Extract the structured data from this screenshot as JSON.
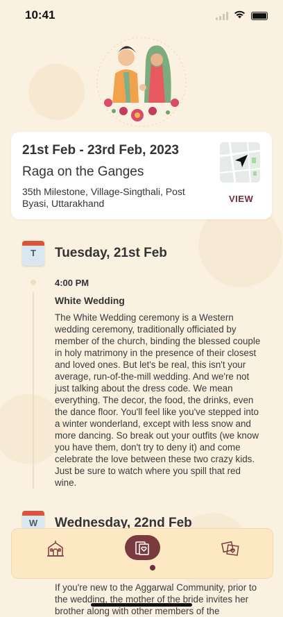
{
  "status_bar": {
    "time": "10:41"
  },
  "event": {
    "dates": "21st Feb - 23rd Feb, 2023",
    "venue": "Raga on the Ganges",
    "address": "35th Milestone, Village-Singthali, Post Byasi, Uttarakhand",
    "view_label": "VIEW"
  },
  "schedule": {
    "days": [
      {
        "calendar_letter": "T",
        "title": "Tuesday, 21st Feb",
        "sessions": [
          {
            "time": "4:00 PM",
            "title": "White Wedding",
            "description": "The White Wedding ceremony is a Western wedding ceremony, traditionally officiated by member of the church, binding the blessed couple in holy matrimony in the presence of their closest and loved ones. But let's be real, this isn't your average, run-of-the-mill wedding. And we're not just talking about the dress code. We mean everything. The decor, the food, the drinks, even the dance floor. You'll feel like you've stepped into a winter wonderland, except with less snow and more dancing. So break out your outfits (we know you have them, don't try to deny it) and come celebrate the love between these two crazy kids. Just be sure to watch where you spill that red wine."
          }
        ]
      },
      {
        "calendar_letter": "W",
        "title": "Wednesday, 22nd Feb",
        "sessions": [
          {
            "description": "If you're new to the Aggarwal Community, prior to the wedding, the mother of the bride invites her brother along with other members of the"
          }
        ]
      }
    ]
  },
  "bottom_nav": {
    "items": [
      {
        "icon": "venue-icon",
        "active": false
      },
      {
        "icon": "schedule-icon",
        "active": true
      },
      {
        "icon": "photos-icon",
        "active": false
      }
    ]
  },
  "colors": {
    "background": "#fbf1e1",
    "accent": "#6d2f3a",
    "nav_background": "#fde8c4",
    "calendar_red": "#d8543d",
    "timeline": "#efdfc1"
  }
}
